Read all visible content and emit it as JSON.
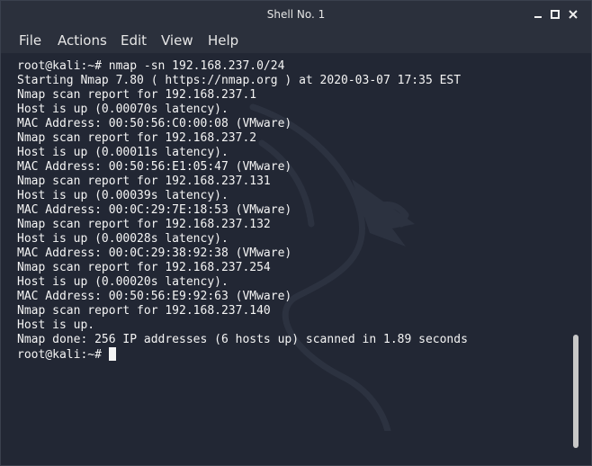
{
  "window": {
    "title": "Shell No. 1",
    "controls": {
      "minimize": "–",
      "maximize": "□",
      "close": "✕"
    }
  },
  "menu": {
    "items": [
      {
        "label": "File"
      },
      {
        "label": "Actions"
      },
      {
        "label": "Edit"
      },
      {
        "label": "View"
      },
      {
        "label": "Help"
      }
    ]
  },
  "terminal": {
    "lines": [
      "root@kali:~# nmap -sn 192.168.237.0/24",
      "Starting Nmap 7.80 ( https://nmap.org ) at 2020-03-07 17:35 EST",
      "Nmap scan report for 192.168.237.1",
      "Host is up (0.00070s latency).",
      "MAC Address: 00:50:56:C0:00:08 (VMware)",
      "Nmap scan report for 192.168.237.2",
      "Host is up (0.00011s latency).",
      "MAC Address: 00:50:56:E1:05:47 (VMware)",
      "Nmap scan report for 192.168.237.131",
      "Host is up (0.00039s latency).",
      "MAC Address: 00:0C:29:7E:18:53 (VMware)",
      "Nmap scan report for 192.168.237.132",
      "Host is up (0.00028s latency).",
      "MAC Address: 00:0C:29:38:92:38 (VMware)",
      "Nmap scan report for 192.168.237.254",
      "Host is up (0.00020s latency).",
      "MAC Address: 00:50:56:E9:92:63 (VMware)",
      "Nmap scan report for 192.168.237.140",
      "Host is up.",
      "Nmap done: 256 IP addresses (6 hosts up) scanned in 1.89 seconds"
    ],
    "prompt": "root@kali:~# ",
    "background_watermark": "kali-dragon-icon"
  },
  "colors": {
    "background": "#222734",
    "text": "#f4f4f4",
    "titlebar": "#2b303c"
  }
}
